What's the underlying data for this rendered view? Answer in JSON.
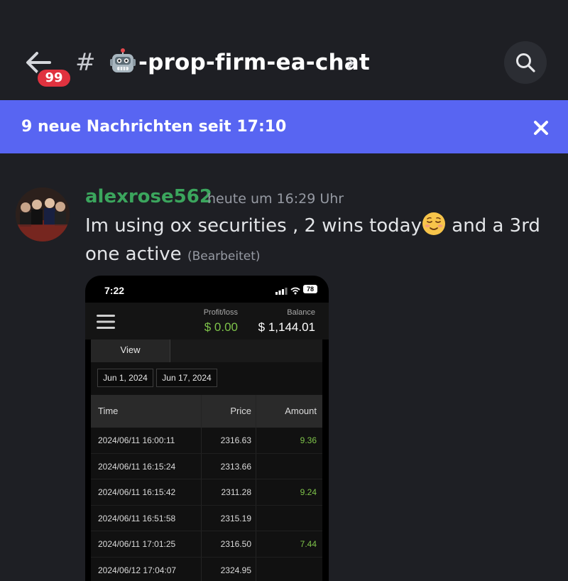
{
  "header": {
    "unread_badge": "99",
    "hash_symbol": "#",
    "channel_name": "-prop-firm-ea-chat",
    "channel_icon": "robot-face-icon",
    "back_icon": "back-arrow-icon",
    "search_icon": "search-icon"
  },
  "banner": {
    "text": "9 neue Nachrichten seit 17:10",
    "close_icon": "close-icon",
    "color": "#5865f2"
  },
  "message": {
    "username": "alexrose562",
    "username_color": "#3ba55d",
    "timestamp": "heute um 16:29 Uhr",
    "text_part1": "Im using ox securities  , 2 wins today",
    "emoji": "relieved-face-icon",
    "text_part2": " and a 3rd one active",
    "edited": "(Bearbeitet)"
  },
  "attachment": {
    "status_time": "7:22",
    "battery": "78",
    "profit_label": "Profit/loss",
    "profit_value": "$ 0.00",
    "balance_label": "Balance",
    "balance_value": "$ 1,144.01",
    "tab_label": "View",
    "date_from": "Jun 1, 2024",
    "date_to": "Jun 17, 2024",
    "columns": [
      "Time",
      "Price",
      "Amount"
    ],
    "rows": [
      {
        "time": "2024/06/11 16:00:11",
        "price": "2316.63",
        "amount": "9.36"
      },
      {
        "time": "2024/06/11 16:15:24",
        "price": "2313.66",
        "amount": ""
      },
      {
        "time": "2024/06/11 16:15:42",
        "price": "2311.28",
        "amount": "9.24"
      },
      {
        "time": "2024/06/11 16:51:58",
        "price": "2315.19",
        "amount": ""
      },
      {
        "time": "2024/06/11 17:01:25",
        "price": "2316.50",
        "amount": "7.44"
      },
      {
        "time": "2024/06/12 17:04:07",
        "price": "2324.95",
        "amount": ""
      }
    ]
  }
}
